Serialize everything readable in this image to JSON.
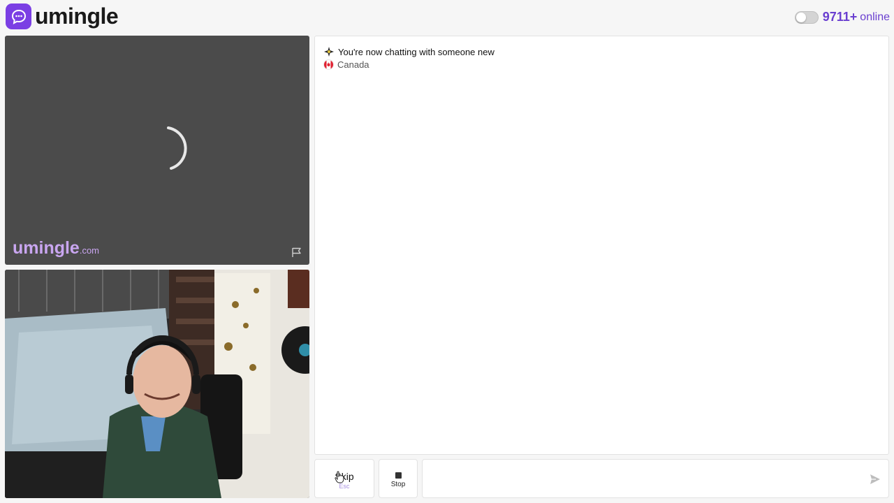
{
  "header": {
    "logo_text": "umingle",
    "online_count": "9711+",
    "online_label": "online",
    "theme_toggle": "off"
  },
  "remote_video": {
    "watermark_main": "umingle",
    "watermark_suffix": ".com",
    "state": "loading"
  },
  "chat": {
    "system_message": "You're now chatting with someone new",
    "country": "Canada"
  },
  "controls": {
    "skip_label": "Skip",
    "skip_hint": "Esc",
    "stop_label": "Stop",
    "message_placeholder": ""
  },
  "colors": {
    "brand": "#7b3fe4",
    "online": "#6a3fd0",
    "watermark": "#c9a6f0"
  },
  "icons": {
    "logo": "chat-bubble-icon",
    "report": "flag-icon",
    "send": "send-icon",
    "system": "sparkle-icon",
    "country": "canada-flag-icon"
  }
}
